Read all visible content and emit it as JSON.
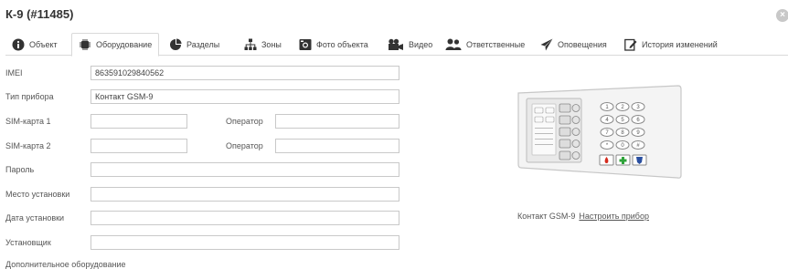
{
  "header": {
    "title": "К-9 (#11485)"
  },
  "tabs": [
    {
      "label": "Объект",
      "icon": "info-icon"
    },
    {
      "label": "Оборудование",
      "icon": "chip-icon"
    },
    {
      "label": "Разделы",
      "icon": "pie-chart-icon"
    },
    {
      "label": "Зоны",
      "icon": "hierarchy-icon"
    },
    {
      "label": "Фото объекта",
      "icon": "camera-icon"
    },
    {
      "label": "Видео",
      "icon": "video-camera-icon"
    },
    {
      "label": "Ответственные",
      "icon": "users-icon"
    },
    {
      "label": "Оповещения",
      "icon": "send-icon"
    },
    {
      "label": "История изменений",
      "icon": "edit-document-icon"
    }
  ],
  "active_tab": "Оборудование",
  "form": {
    "imei": {
      "label": "IMEI",
      "value": "863591029840562"
    },
    "device_type": {
      "label": "Тип прибора",
      "value": "Контакт GSM-9"
    },
    "sim1": {
      "label": "SIM-карта 1",
      "value": "",
      "operator_label": "Оператор",
      "operator_value": ""
    },
    "sim2": {
      "label": "SIM-карта 2",
      "value": "",
      "operator_label": "Оператор",
      "operator_value": ""
    },
    "password": {
      "label": "Пароль",
      "value": ""
    },
    "location": {
      "label": "Место установки",
      "value": ""
    },
    "install_date": {
      "label": "Дата установки",
      "value": ""
    },
    "installer": {
      "label": "Установщик",
      "value": ""
    },
    "extra_equipment": {
      "label": "Дополнительное оборудование"
    }
  },
  "device": {
    "name": "Контакт GSM-9",
    "configure_link": "Настроить прибор",
    "keypad_keys": [
      "1",
      "2",
      "3",
      "4",
      "5",
      "6",
      "7",
      "8",
      "9",
      "*",
      "0",
      "#"
    ]
  }
}
